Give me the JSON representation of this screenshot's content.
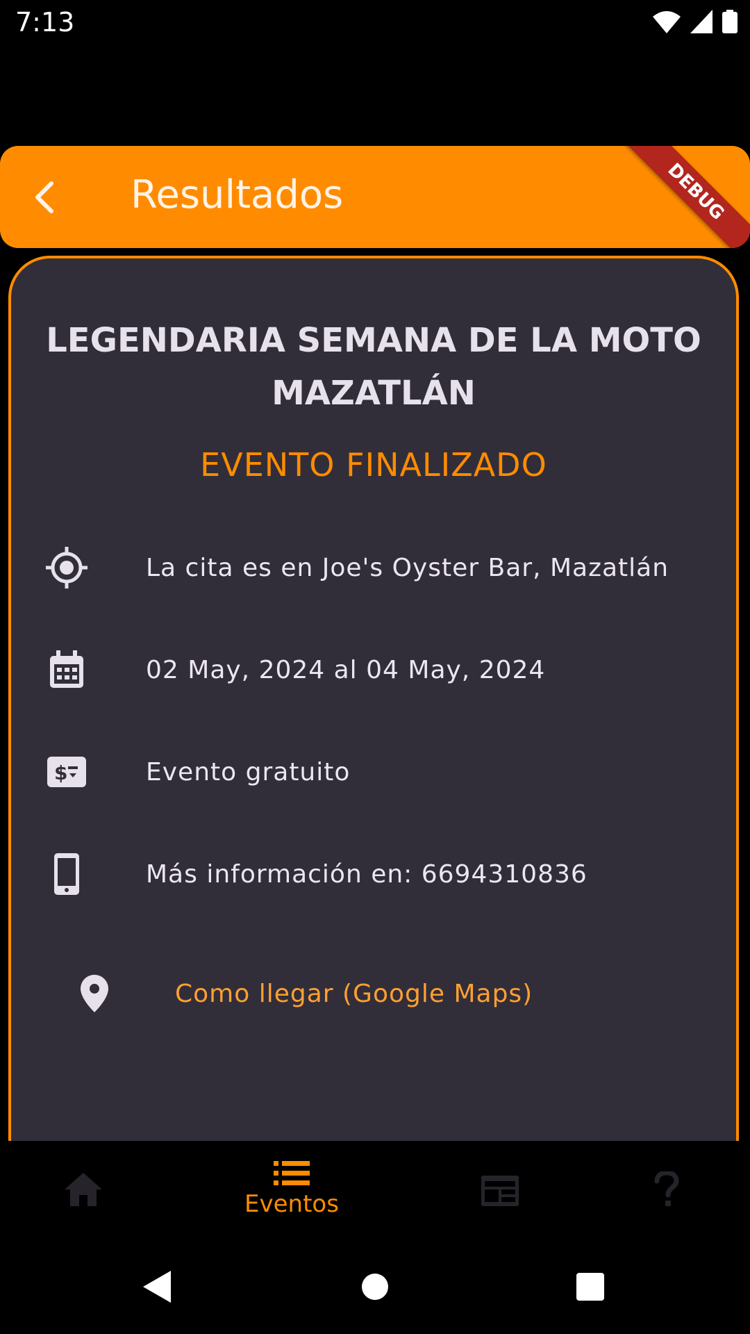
{
  "status_bar": {
    "time": "7:13"
  },
  "app_bar": {
    "title": "Resultados",
    "debug_label": "DEBUG"
  },
  "event": {
    "title": "LEGENDARIA SEMANA DE LA MOTO MAZATLÁN",
    "status": "EVENTO FINALIZADO",
    "location": "La cita es en Joe's Oyster Bar, Mazatlán",
    "dates": "02 May, 2024 al 04 May, 2024",
    "price": "Evento gratuito",
    "contact": "Más información en: 6694310836",
    "maps_link": "Como llegar (Google Maps)"
  },
  "bottom_nav": {
    "items": [
      {
        "icon": "home-icon",
        "label": ""
      },
      {
        "icon": "list-icon",
        "label": "Eventos",
        "active": true
      },
      {
        "icon": "newspaper-icon",
        "label": ""
      },
      {
        "icon": "help-icon",
        "label": ""
      }
    ]
  },
  "colors": {
    "accent": "#ff8c00",
    "card_bg": "#322e39",
    "debug": "#b3261e"
  }
}
